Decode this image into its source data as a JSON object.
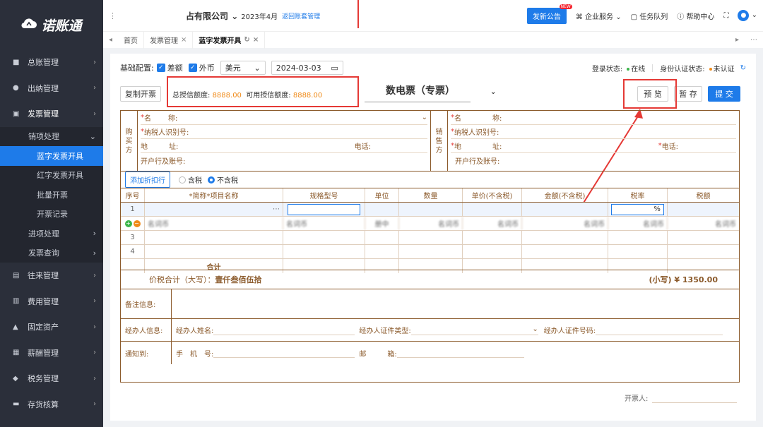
{
  "sidebar": {
    "logo": "诺账通",
    "items": [
      {
        "label": "总账管理",
        "icon": "ledger-icon"
      },
      {
        "label": "出纳管理",
        "icon": "cashier-icon"
      },
      {
        "label": "发票管理",
        "icon": "invoice-icon"
      },
      {
        "label": "往来管理",
        "icon": "contact-icon"
      },
      {
        "label": "费用管理",
        "icon": "expense-icon"
      },
      {
        "label": "固定资产",
        "icon": "asset-icon"
      },
      {
        "label": "薪酬管理",
        "icon": "salary-icon"
      },
      {
        "label": "税务管理",
        "icon": "tax-icon"
      },
      {
        "label": "存货核算",
        "icon": "inventory-icon"
      }
    ],
    "sub": {
      "sales": "销项处理",
      "blue": "蓝字发票开具",
      "red": "红字发票开具",
      "batch": "批量开票",
      "record": "开票记录",
      "input": "进项处理",
      "query": "发票查询"
    }
  },
  "topbar": {
    "company": "占有限公司",
    "period": "2023年4月",
    "back_link": "返回账套管理",
    "notice": "发新公告",
    "new_badge": "NEW",
    "enterprise": "企业服务",
    "tasks": "任务队列",
    "help": "帮助中心"
  },
  "tabs": [
    {
      "label": "首页"
    },
    {
      "label": "发票管理"
    },
    {
      "label": "蓝字发票开具"
    }
  ],
  "config": {
    "label": "基础配置:",
    "diff": "差额",
    "foreign": "外币",
    "currency": "美元",
    "date": "2024-03-03",
    "login_label": "登录状态:",
    "login_value": "在线",
    "auth_label": "身份认证状态:",
    "auth_value": "未认证"
  },
  "actions": {
    "copy": "复制开票",
    "total_credit_label": "总授信额度:",
    "total_credit": "8888.00",
    "avail_credit_label": "可用授信额度:",
    "avail_credit": "8888.00",
    "invoice_type": "数电票（专票）",
    "preview": "预 览",
    "save": "暂 存",
    "submit": "提 交"
  },
  "buyer": {
    "label": [
      "购",
      "买",
      "方"
    ],
    "name": "名",
    "name2": "称:",
    "tax_id": "纳税人识别号:",
    "addr": "地",
    "addr2": "址:",
    "phone": "电话:",
    "bank": "开户行及账号:"
  },
  "seller": {
    "label": [
      "销",
      "售",
      "方"
    ],
    "name": "名",
    "name2": "称:",
    "tax_id": "纳税人识别号:",
    "addr": "地",
    "addr2": "址:",
    "phone": "电话:",
    "bank": "开户行及账号:"
  },
  "discount": {
    "button": "添加折扣行",
    "tax_incl": "含税",
    "tax_excl": "不含税"
  },
  "table": {
    "headers": [
      "序号",
      "*简称*项目名称",
      "规格型号",
      "单位",
      "数量",
      "单价(不含税)",
      "金额(不含税)",
      "税率",
      "税额"
    ],
    "rows": [
      "1",
      "",
      "3",
      "4"
    ],
    "percent": "%",
    "blur_text": "名词币",
    "blur_unit": "册中",
    "total": "合计"
  },
  "summary": {
    "upper_label": "价税合计（大写）：",
    "upper_value": "壹仟叁佰伍拾",
    "lower": "(小写) ¥ 1350.00"
  },
  "remark": {
    "label": "备注信息:"
  },
  "agent": {
    "label": "经办人信息:",
    "name": "经办人姓名:",
    "id_type": "经办人证件类型:",
    "id_no": "经办人证件号码:"
  },
  "notify": {
    "label": "通知到:",
    "phone": "手　机　号:",
    "email": "邮　　　箱:"
  },
  "issuer": "开票人:"
}
